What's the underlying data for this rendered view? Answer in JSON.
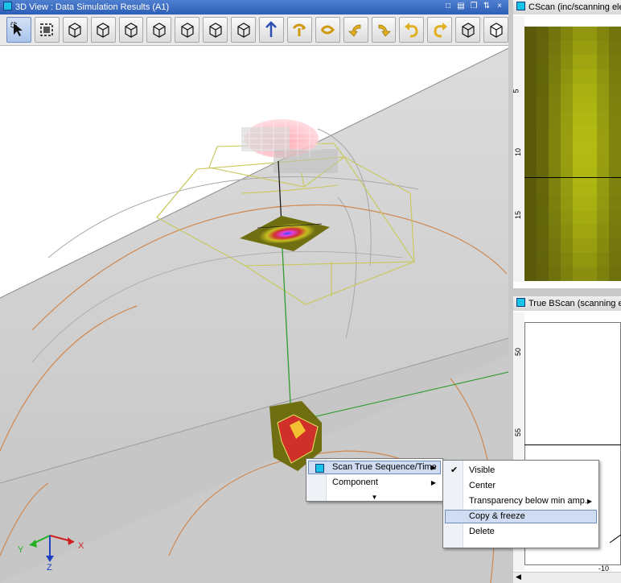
{
  "view3d": {
    "title": "3D View : Data Simulation Results (A1)",
    "toolbar_icons": [
      "select-pointer-icon",
      "fit-view-icon",
      "view-iso-1-icon",
      "view-iso-2-icon",
      "view-front-icon",
      "view-back-icon",
      "view-left-icon",
      "view-right-icon",
      "view-top-icon",
      "axis-up-icon",
      "rotate-cw-icon",
      "rotate-ccw-icon",
      "turn-left-icon",
      "turn-right-icon",
      "undo-icon",
      "redo-icon",
      "wireframe-box-icon",
      "solid-box-icon"
    ],
    "axes": {
      "x": "X",
      "y": "Y",
      "z": "Z"
    }
  },
  "cscan": {
    "title": "CScan (inc/scanning elec",
    "y_ticks": [
      "5",
      "10",
      "15"
    ]
  },
  "bscan": {
    "title": "True BScan (scanning elec",
    "y_ticks": [
      "50",
      "55"
    ],
    "x_ticks": [
      "-10"
    ]
  },
  "context_menu": {
    "items": [
      {
        "label": "Scan True Sequence/Time",
        "has_submenu": true,
        "icon": "scan-sequence-icon",
        "highlighted": true
      },
      {
        "label": "Component",
        "has_submenu": true
      },
      {
        "label": "▼",
        "more": true
      }
    ]
  },
  "submenu": {
    "items": [
      {
        "label": "Visible",
        "checked": true
      },
      {
        "label": "Center"
      },
      {
        "label": "Transparency below min amp.",
        "has_submenu": true
      },
      {
        "label": "Copy & freeze",
        "highlighted": true
      },
      {
        "label": "Delete"
      }
    ]
  },
  "colors": {
    "titlebar_active": "#2d5fb7",
    "pipe_gray": "#c8c8c8",
    "cscan_olive": "#7a7a10",
    "wireframe_yellow": "#c8c85a",
    "ray_green": "#2f9a2f",
    "defect_red": "#d0302a",
    "circle_orange": "#d08850"
  }
}
